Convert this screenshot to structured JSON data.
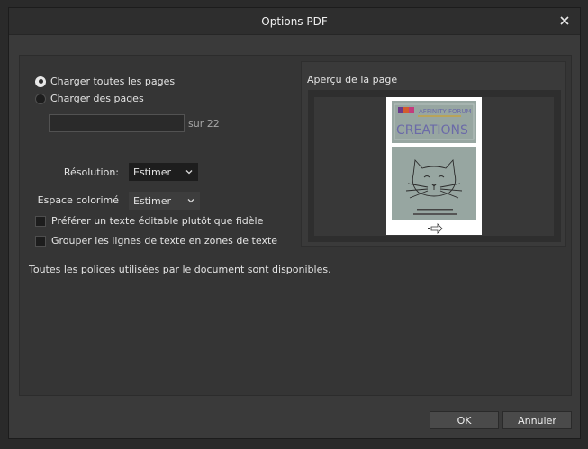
{
  "dialog": {
    "title": "Options PDF",
    "close_icon": "close-icon"
  },
  "pages": {
    "load_all_label": "Charger toutes les pages",
    "load_all_selected": true,
    "load_some_label": "Charger des pages",
    "load_some_selected": false,
    "page_range_value": "",
    "page_total_label": "sur 22"
  },
  "resolution": {
    "label": "Résolution:",
    "value": "Estimer"
  },
  "color_space": {
    "label": "Espace colorimé",
    "value": "Estimer"
  },
  "options": {
    "prefer_editable_label": "Préférer un texte éditable plutôt que fidèle",
    "prefer_editable_checked": false,
    "group_lines_label": "Grouper les lignes de texte en zones de texte",
    "group_lines_checked": false
  },
  "preview": {
    "title": "Aperçu de la page",
    "thumbnail": {
      "banner_line1": "AFFINITY FORUM",
      "banner_line2": "CREATIONS",
      "arrow_icon": "arrow-right-icon"
    }
  },
  "status_text": "Toutes les polices utilisées par le document sont disponibles.",
  "buttons": {
    "ok_label": "OK",
    "cancel_label": "Annuler"
  },
  "colors": {
    "dialog_bg": "#3a3a3a",
    "titlebar_bg": "#2e2e2e",
    "thumbnail_bg": "#97a6a1",
    "thumbnail_text": "#6b6aa8"
  }
}
